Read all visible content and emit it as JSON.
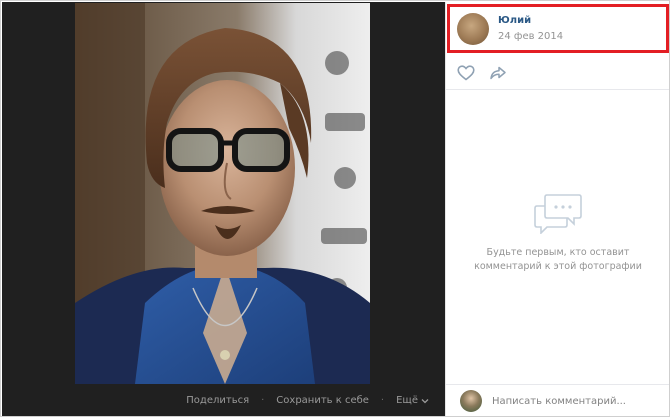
{
  "viewer": {
    "share_label": "Поделиться",
    "save_label": "Сохранить к себе",
    "more_label": "Ещё"
  },
  "post": {
    "author_name": "Юлий",
    "date": "24 фев 2014"
  },
  "comments": {
    "empty_text": "Будьте первым, кто оставит комментарий к этой фотографии",
    "placeholder": "Написать комментарий..."
  },
  "colors": {
    "highlight": "#e31e24",
    "link": "#2a5885",
    "muted": "#939393",
    "viewer_bg": "#202020"
  },
  "icons": [
    "heart-icon",
    "share-icon",
    "comments-empty-icon",
    "chevron-down-icon"
  ]
}
